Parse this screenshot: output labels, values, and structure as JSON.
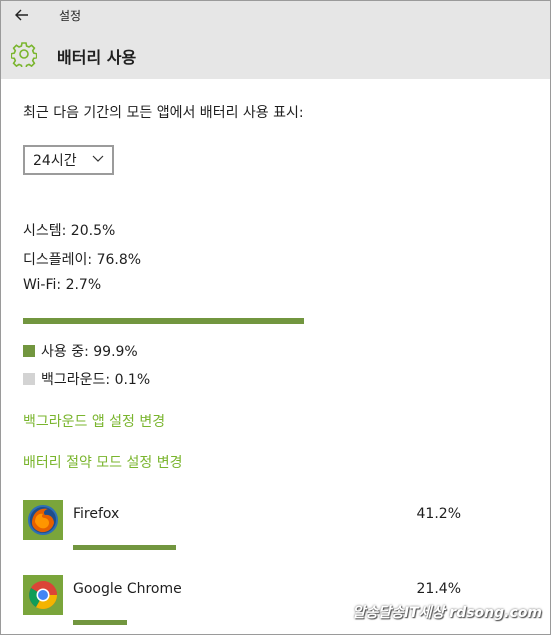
{
  "titlebar": {
    "back_icon": "back-arrow-icon",
    "title": "설정"
  },
  "header": {
    "icon": "gear-icon",
    "title": "배터리 사용"
  },
  "intro_text": "최근 다음 기간의 모든 앱에서 배터리 사용 표시:",
  "period_select": {
    "value": "24시간",
    "icon": "chevron-down-icon"
  },
  "stats": [
    {
      "label": "시스템: 20.5%"
    },
    {
      "label": "디스플레이: 76.8%"
    },
    {
      "label": "Wi-Fi: 2.7%"
    }
  ],
  "usage_fraction": 0.999,
  "legend": {
    "in_use": {
      "label": "사용 중: 99.9%",
      "color": "#72963f"
    },
    "background": {
      "label": "백그라운드: 0.1%",
      "color": "#d3d3d3"
    }
  },
  "links": {
    "background_apps": "백그라운드 앱 설정 변경",
    "battery_saver": "배터리 절약 모드 설정 변경"
  },
  "accent_color": "#7ab52e",
  "apps": [
    {
      "name": "Firefox",
      "percent_label": "41.2%",
      "fraction": 0.412,
      "icon": "firefox-icon"
    },
    {
      "name": "Google Chrome",
      "percent_label": "21.4%",
      "fraction": 0.214,
      "icon": "chrome-icon"
    }
  ],
  "watermark": "알송달송IT세상 rdsong.com"
}
